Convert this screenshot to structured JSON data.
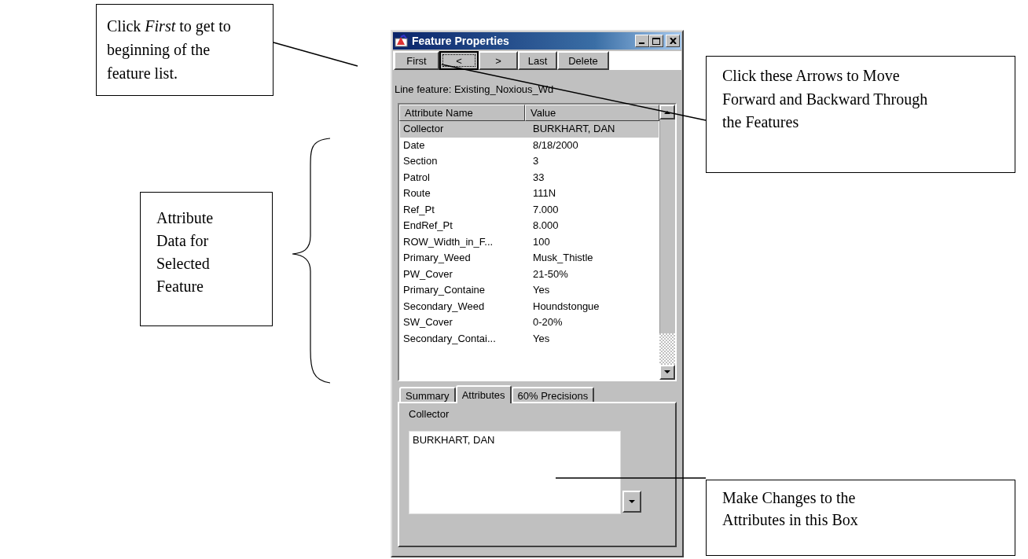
{
  "callouts": [
    {
      "text": "Click *First* to get to beginning of the feature list.",
      "kind": "top-left"
    },
    {
      "text": "Click these Arrows to Move Forward and Backward Through the Features",
      "kind": "top-right"
    },
    {
      "text": "Attribute Data for Selected Feature",
      "kind": "left"
    },
    {
      "text": "Make Changes to the Attributes in this Box",
      "kind": "bottom-right"
    }
  ],
  "window": {
    "title": "Feature Properties",
    "buttons": [
      {
        "label": "First",
        "focused": false
      },
      {
        "label": "<",
        "focused": true
      },
      {
        "label": ">",
        "focused": false
      },
      {
        "label": "Last",
        "focused": false
      },
      {
        "label": "Delete",
        "focused": false
      }
    ],
    "feature_label": "Line feature: Existing_Noxious_Wd",
    "table": {
      "columns": [
        "Attribute Name",
        "Value"
      ],
      "rows": [
        {
          "name": "Collector",
          "value": "BURKHART, DAN",
          "selected": true
        },
        {
          "name": "Date",
          "value": "8/18/2000",
          "selected": false
        },
        {
          "name": "Section",
          "value": "3",
          "selected": false
        },
        {
          "name": "Patrol",
          "value": "33",
          "selected": false
        },
        {
          "name": "Route",
          "value": "111N",
          "selected": false
        },
        {
          "name": "Ref_Pt",
          "value": "7.000",
          "selected": false
        },
        {
          "name": "EndRef_Pt",
          "value": "8.000",
          "selected": false
        },
        {
          "name": "ROW_Width_in_F...",
          "value": "100",
          "selected": false
        },
        {
          "name": "Primary_Weed",
          "value": "Musk_Thistle",
          "selected": false
        },
        {
          "name": "PW_Cover",
          "value": "21-50%",
          "selected": false
        },
        {
          "name": "Primary_Containe",
          "value": "Yes",
          "selected": false
        },
        {
          "name": "Secondary_Weed",
          "value": "Houndstongue",
          "selected": false
        },
        {
          "name": "SW_Cover",
          "value": "0-20%",
          "selected": false
        },
        {
          "name": "Secondary_Contai...",
          "value": "Yes",
          "selected": false
        }
      ]
    },
    "tabs": [
      {
        "label": "Summary",
        "selected": false
      },
      {
        "label": "Attributes",
        "selected": true
      },
      {
        "label": "60% Precisions",
        "selected": false
      }
    ],
    "field": {
      "label": "Collector",
      "value": "BURKHART, DAN"
    }
  }
}
